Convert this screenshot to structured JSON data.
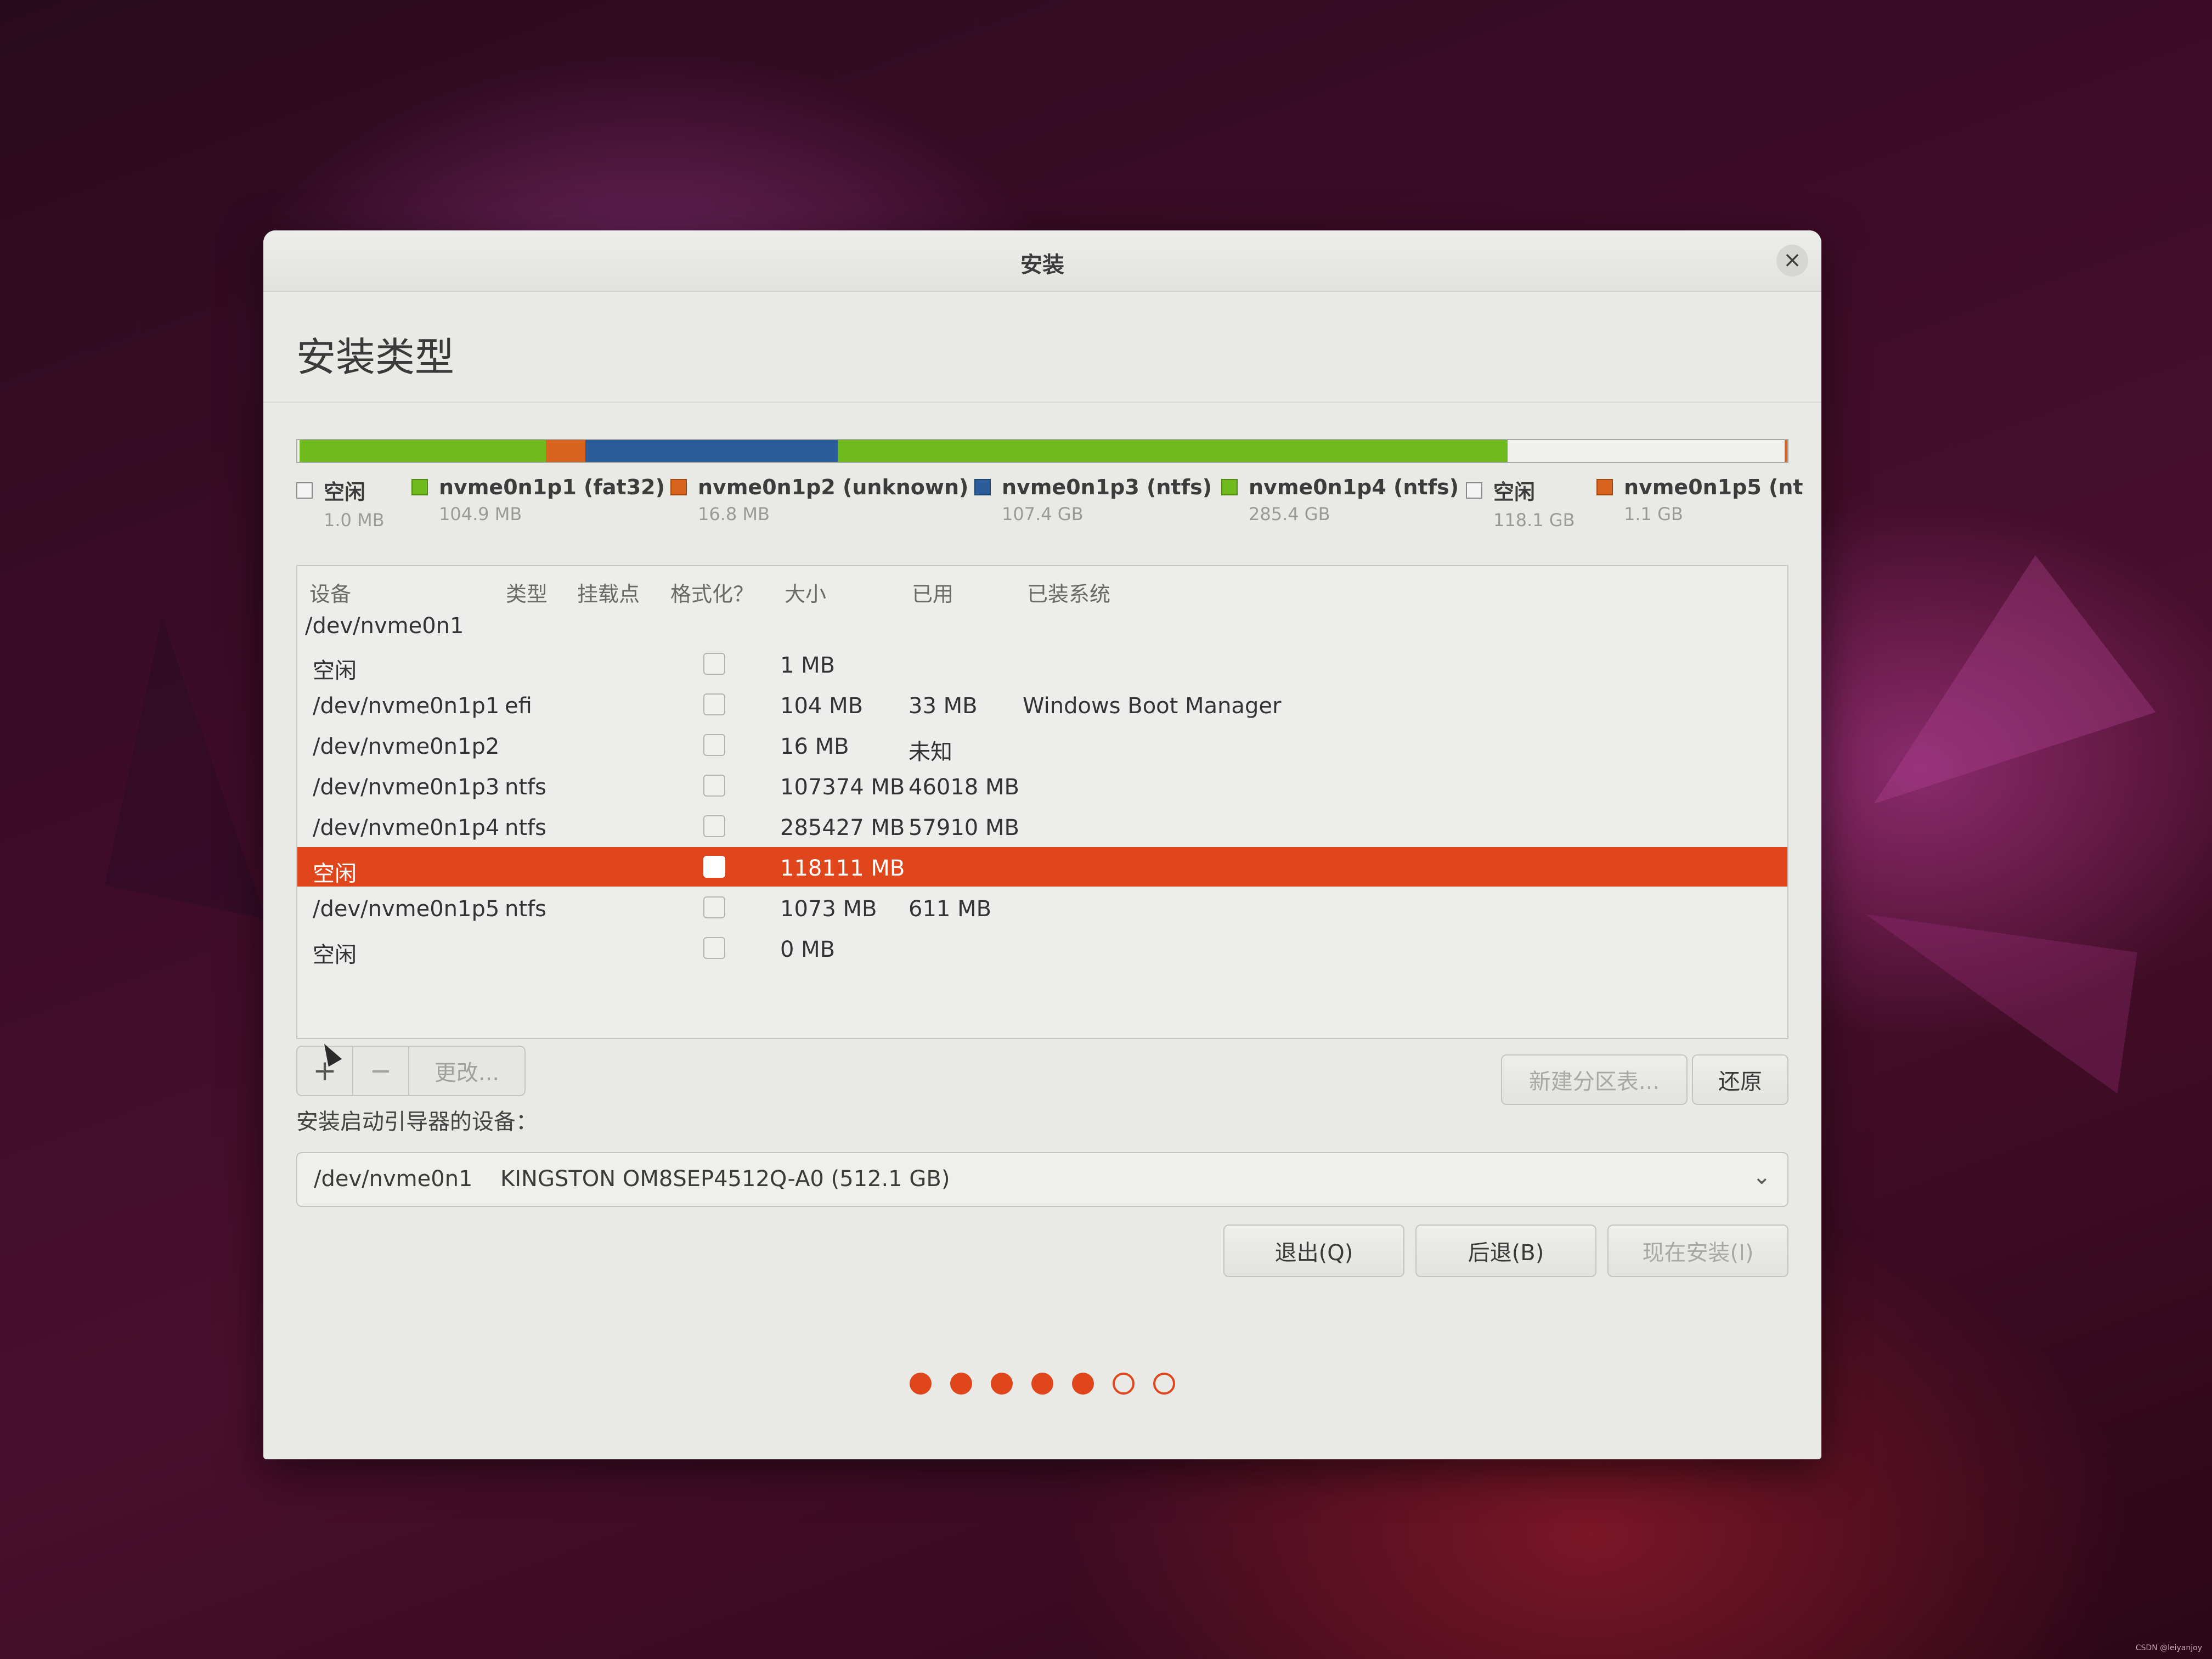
{
  "window": {
    "title": "安装"
  },
  "page": {
    "title": "安装类型"
  },
  "partition_bar": [
    {
      "color": "#f0f0ee",
      "share": 0.00195
    },
    {
      "color": "#6fba1c",
      "share": 0.2049
    },
    {
      "color": "#d9641e",
      "share": 0.0328
    },
    {
      "color": "#2b5d9a",
      "share": 0.2097
    },
    {
      "color": "#6fba1c",
      "share": 0.5574
    },
    {
      "color": "#f0f0ee",
      "share": 0.2306
    },
    {
      "color": "#d9641e",
      "share": 0.0021
    }
  ],
  "legend": [
    {
      "name": "空闲",
      "size": "1.0 MB",
      "color": "#f4f4f4"
    },
    {
      "name": "nvme0n1p1 (fat32)",
      "size": "104.9 MB",
      "color": "#6fba1c"
    },
    {
      "name": "nvme0n1p2 (unknown)",
      "size": "16.8 MB",
      "color": "#d9641e"
    },
    {
      "name": "nvme0n1p3 (ntfs)",
      "size": "107.4 GB",
      "color": "#2b5d9a"
    },
    {
      "name": "nvme0n1p4 (ntfs)",
      "size": "285.4 GB",
      "color": "#6fba1c"
    },
    {
      "name": "空闲",
      "size": "118.1 GB",
      "color": "#f4f4f4"
    },
    {
      "name": "nvme0n1p5 (nt",
      "size": "1.1 GB",
      "color": "#d9641e"
    }
  ],
  "table": {
    "headers": {
      "device": "设备",
      "type": "类型",
      "mount": "挂载点",
      "format": "格式化？",
      "size": "大小",
      "used": "已用",
      "system": "已装系统"
    },
    "disk": "/dev/nvme0n1",
    "rows": [
      {
        "device": "空闲",
        "type": "",
        "size": "1 MB",
        "used": "",
        "system": ""
      },
      {
        "device": "/dev/nvme0n1p1",
        "type": "efi",
        "size": "104 MB",
        "used": "33 MB",
        "system": "Windows Boot Manager"
      },
      {
        "device": "/dev/nvme0n1p2",
        "type": "",
        "size": "16 MB",
        "used": "未知",
        "system": ""
      },
      {
        "device": "/dev/nvme0n1p3",
        "type": "ntfs",
        "size": "107374 MB",
        "used": "46018 MB",
        "system": ""
      },
      {
        "device": "/dev/nvme0n1p4",
        "type": "ntfs",
        "size": "285427 MB",
        "used": "57910 MB",
        "system": ""
      },
      {
        "device": "空闲",
        "type": "",
        "size": "118111 MB",
        "used": "",
        "system": ""
      },
      {
        "device": "/dev/nvme0n1p5",
        "type": "ntfs",
        "size": "1073 MB",
        "used": "611 MB",
        "system": ""
      },
      {
        "device": "空闲",
        "type": "",
        "size": "0 MB",
        "used": "",
        "system": ""
      }
    ],
    "selected_index": 5
  },
  "toolbar": {
    "add": "+",
    "remove": "−",
    "change": "更改...",
    "new_table": "新建分区表...",
    "revert": "还原"
  },
  "boot": {
    "label": "安装启动引导器的设备：",
    "device": "/dev/nvme0n1",
    "description": "KINGSTON OM8SEP4512Q-A0 (512.1 GB)"
  },
  "nav": {
    "quit": "退出(Q)",
    "back": "后退(B)",
    "install": "现在安装(I)"
  },
  "progress": {
    "total_steps": 7,
    "completed_steps": 5
  },
  "watermark": "CSDN @leiyanjoy",
  "colors": {
    "accent": "#e0461c"
  }
}
